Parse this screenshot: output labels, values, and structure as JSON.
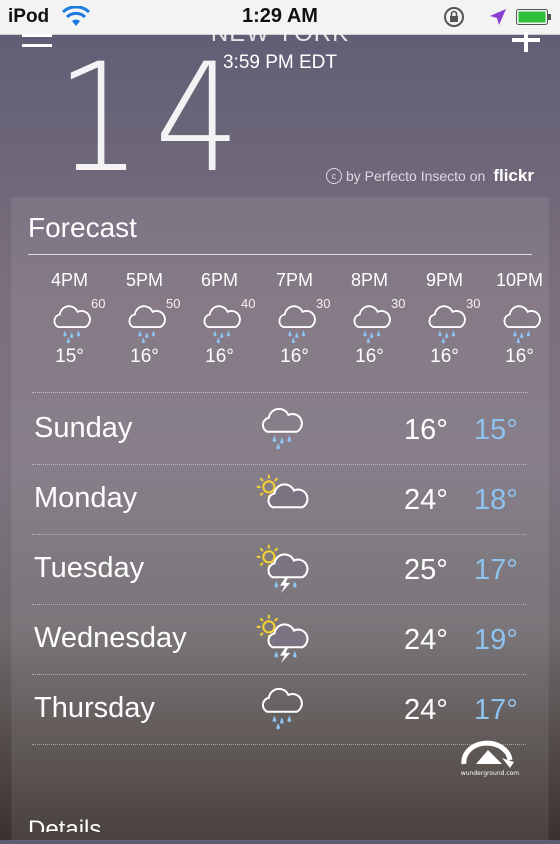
{
  "status_bar": {
    "carrier": "iPod",
    "time": "1:29 AM"
  },
  "header": {
    "city": "NEW YORK",
    "local_time": "3:59 PM EDT",
    "current_temp": "14",
    "photo_credit": "by Perfecto Insecto on",
    "photo_source": "flickr"
  },
  "forecast": {
    "title": "Forecast",
    "hourly": [
      {
        "time": "4PM",
        "pop": "60",
        "temp": "15°",
        "icon": "rain-cloud-icon"
      },
      {
        "time": "5PM",
        "pop": "50",
        "temp": "16°",
        "icon": "rain-cloud-icon"
      },
      {
        "time": "6PM",
        "pop": "40",
        "temp": "16°",
        "icon": "rain-cloud-icon"
      },
      {
        "time": "7PM",
        "pop": "30",
        "temp": "16°",
        "icon": "rain-cloud-icon"
      },
      {
        "time": "8PM",
        "pop": "30",
        "temp": "16°",
        "icon": "rain-cloud-icon"
      },
      {
        "time": "9PM",
        "pop": "30",
        "temp": "16°",
        "icon": "rain-cloud-icon"
      },
      {
        "time": "10PM",
        "pop": "",
        "temp": "16°",
        "icon": "rain-cloud-icon"
      }
    ],
    "daily": [
      {
        "day": "Sunday",
        "hi": "16°",
        "lo": "15°",
        "icon": "rain-cloud-icon"
      },
      {
        "day": "Monday",
        "hi": "24°",
        "lo": "18°",
        "icon": "partly-sunny-icon"
      },
      {
        "day": "Tuesday",
        "hi": "25°",
        "lo": "17°",
        "icon": "sun-thunderstorm-icon"
      },
      {
        "day": "Wednesday",
        "hi": "24°",
        "lo": "19°",
        "icon": "sun-thunderstorm-icon"
      },
      {
        "day": "Thursday",
        "hi": "24°",
        "lo": "17°",
        "icon": "rain-cloud-icon"
      }
    ]
  },
  "details_label": "Details",
  "colors": {
    "low_temp": "#8ec2ef",
    "status_bar_bg": "#f3f3f3"
  }
}
